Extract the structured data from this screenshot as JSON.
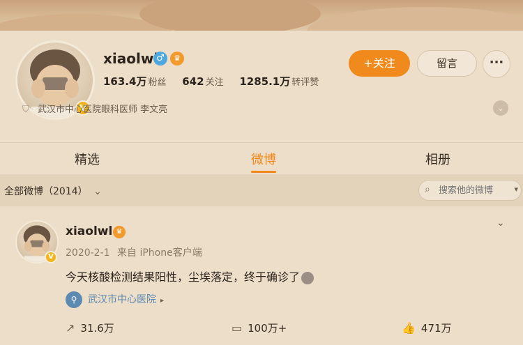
{
  "profile": {
    "username": "xiaolwl",
    "gender_icon": "male-icon",
    "vip_icon": "vip-crown-icon",
    "verified_badge": "V",
    "stats": [
      {
        "value": "163.4万",
        "label": "粉丝"
      },
      {
        "value": "642",
        "label": "关注"
      },
      {
        "value": "1285.1万",
        "label": "转评赞"
      }
    ],
    "verification": "武汉市中心医院眼科医师 李文亮",
    "follow_button": "+关注",
    "message_button": "留言",
    "more_button": "···"
  },
  "tabs": [
    {
      "label": "精选",
      "active": false
    },
    {
      "label": "微博",
      "active": true
    },
    {
      "label": "相册",
      "active": false
    }
  ],
  "filter": {
    "label": "全部微博（2014）",
    "search_placeholder": "搜索他的微博"
  },
  "post": {
    "username": "xiaolwl",
    "date": "2020-2-1",
    "source": "来自 iPhone客户端",
    "text": "今天核酸检测结果阳性，尘埃落定，终于确诊了",
    "location": "武汉市中心医院",
    "reposts": "31.6万",
    "comments": "100万+",
    "likes": "471万"
  },
  "colors": {
    "accent": "#f08a1c",
    "background": "#ecdec9",
    "link": "#5c8ab0"
  }
}
